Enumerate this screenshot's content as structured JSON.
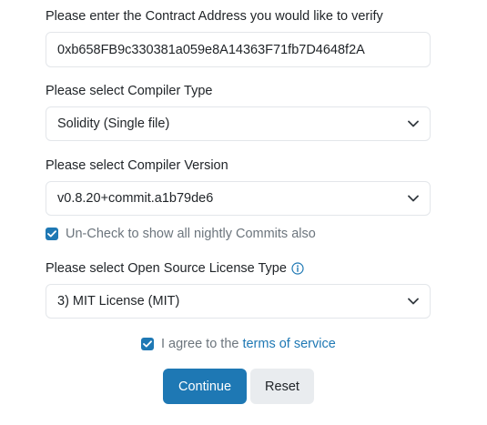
{
  "address": {
    "label": "Please enter the Contract Address you would like to verify",
    "value": "0xb658FB9c330381a059e8A14363F71fb7D4648f2A"
  },
  "compiler_type": {
    "label": "Please select Compiler Type",
    "selected": "Solidity (Single file)"
  },
  "compiler_version": {
    "label": "Please select Compiler Version",
    "selected": "v0.8.20+commit.a1b79de6"
  },
  "nightly": {
    "checked": true,
    "label": "Un-Check to show all nightly Commits also"
  },
  "license": {
    "label": "Please select Open Source License Type",
    "info_icon": "info-circle-icon",
    "selected": "3) MIT License (MIT)"
  },
  "terms": {
    "checked": true,
    "prefix": "I agree to the",
    "link_text": "terms of service"
  },
  "buttons": {
    "continue_label": "Continue",
    "reset_label": "Reset"
  },
  "colors": {
    "primary": "#1e78b4",
    "secondary_bg": "#e9ecef",
    "border": "#e3e6ea"
  }
}
